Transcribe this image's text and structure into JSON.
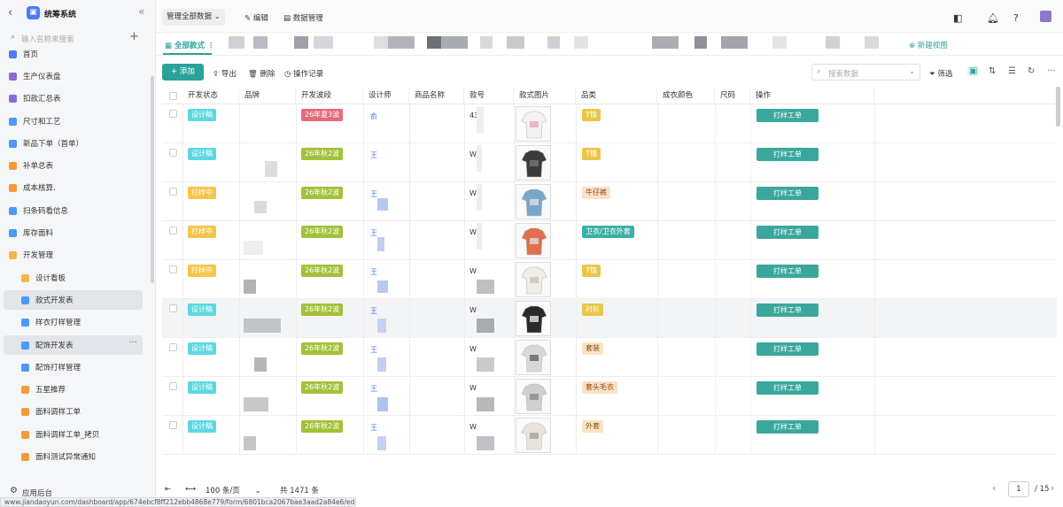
{
  "sidebar": {
    "app_title": "统筹系统",
    "back_icon": "chevron-left-icon",
    "collapse_icon": "double-chevron-left-icon",
    "search_placeholder": "输入名称来搜索",
    "items": [
      {
        "label": "首页",
        "color": "#4a7cf6",
        "sub": false,
        "selected": false
      },
      {
        "label": "生产仪表盘",
        "color": "#8a6ad6",
        "sub": false,
        "selected": false
      },
      {
        "label": "扣款汇总表",
        "color": "#8a6ad6",
        "sub": false,
        "selected": false
      },
      {
        "label": "尺寸和工艺",
        "color": "#4a9af6",
        "sub": false,
        "selected": false
      },
      {
        "label": "新品下单（首单）",
        "color": "#4a9af6",
        "sub": false,
        "selected": false
      },
      {
        "label": "补单总表",
        "color": "#f59a3a",
        "sub": false,
        "selected": false
      },
      {
        "label": "成本核算.",
        "color": "#f59a3a",
        "sub": false,
        "selected": false
      },
      {
        "label": "扫条码看信息",
        "color": "#4a9af6",
        "sub": false,
        "selected": false
      },
      {
        "label": "库存面料",
        "color": "#4a9af6",
        "sub": false,
        "selected": false
      },
      {
        "label": "开发管理",
        "color": "#f5b54a",
        "sub": false,
        "selected": false
      },
      {
        "label": "设计看板",
        "color": "#f5b54a",
        "sub": true,
        "selected": false
      },
      {
        "label": "款式开发表",
        "color": "#4a9af6",
        "sub": true,
        "selected": true
      },
      {
        "label": "样衣打样管理",
        "color": "#4a9af6",
        "sub": true,
        "selected": false
      },
      {
        "label": "配饰开发表",
        "color": "#4a9af6",
        "sub": true,
        "selected": true
      },
      {
        "label": "配饰打样管理",
        "color": "#4a9af6",
        "sub": true,
        "selected": false
      },
      {
        "label": "五星推荐",
        "color": "#f59a3a",
        "sub": true,
        "selected": false
      },
      {
        "label": "面料调样工单",
        "color": "#f59a3a",
        "sub": true,
        "selected": false
      },
      {
        "label": "面料调样工单_拷贝",
        "color": "#f59a3a",
        "sub": true,
        "selected": false
      },
      {
        "label": "面料测试异常通知",
        "color": "#f59a3a",
        "sub": true,
        "selected": false
      }
    ],
    "more_label": "···",
    "bottom_label": "应用后台"
  },
  "url": "www.jiandaoyun.com/dashboard/app/674ebcf8ff212ebb4868e779/form/6801bca2067bae3aad2a84e6/edit",
  "topbar": {
    "manage_label": "管理全部数据",
    "edit_label": "编辑",
    "data_label": "数据管理"
  },
  "tabs": {
    "active_label": "全部款式",
    "new_view_label": "新建视图"
  },
  "toolbar": {
    "add_label": "+ 添加",
    "export_label": "导出",
    "delete_label": "删除",
    "log_label": "操作记录",
    "search_placeholder": "搜索数据",
    "filter_label": "筛选"
  },
  "table": {
    "columns": [
      "开发状态",
      "品牌",
      "开发波段",
      "设计师",
      "商品名称",
      "款号",
      "款式图片",
      "品类",
      "成衣颜色",
      "尺码",
      "操作"
    ],
    "op_label": "打样工单",
    "rows": [
      {
        "status": "设计稿",
        "status_type": "design",
        "wave": "26年夏3波",
        "wave_red": true,
        "designer": "俞",
        "style_no": "43",
        "category": "T恤",
        "cat_type": "yellow"
      },
      {
        "status": "设计稿",
        "status_type": "design",
        "wave": "26年秋2波",
        "wave_red": false,
        "designer": "王",
        "style_no": "W",
        "category": "T恤",
        "cat_type": "yellow"
      },
      {
        "status": "打样中",
        "status_type": "sample",
        "wave": "26年秋2波",
        "wave_red": false,
        "designer": "王",
        "style_no": "W",
        "category": "牛仔裤",
        "cat_type": "orange"
      },
      {
        "status": "打样中",
        "status_type": "sample",
        "wave": "26年秋2波",
        "wave_red": false,
        "designer": "王",
        "style_no": "W",
        "category": "卫衣/卫衣外套",
        "cat_type": "teal"
      },
      {
        "status": "打样中",
        "status_type": "sample",
        "wave": "26年秋2波",
        "wave_red": false,
        "designer": "王",
        "style_no": "W",
        "category": "T恤",
        "cat_type": "yellow"
      },
      {
        "status": "设计稿",
        "status_type": "design",
        "wave": "26年秋2波",
        "wave_red": false,
        "designer": "王",
        "style_no": "W",
        "category": "衬衫",
        "cat_type": "yellow"
      },
      {
        "status": "设计稿",
        "status_type": "design",
        "wave": "26年秋2波",
        "wave_red": false,
        "designer": "王",
        "style_no": "W",
        "category": "套装",
        "cat_type": "peach"
      },
      {
        "status": "设计稿",
        "status_type": "design",
        "wave": "26年秋2波",
        "wave_red": false,
        "designer": "王",
        "style_no": "W",
        "category": "套头毛衣",
        "cat_type": "orange"
      },
      {
        "status": "设计稿",
        "status_type": "design",
        "wave": "26年秋2波",
        "wave_red": false,
        "designer": "王",
        "style_no": "W",
        "category": "外套",
        "cat_type": "peach"
      }
    ]
  },
  "footer": {
    "page_size": "100 条/页",
    "total": "共 1471 条",
    "page": "1",
    "page_total": "/ 15"
  },
  "colors": {
    "accent": "#2aa29a",
    "op_button": "#3aa79c"
  }
}
